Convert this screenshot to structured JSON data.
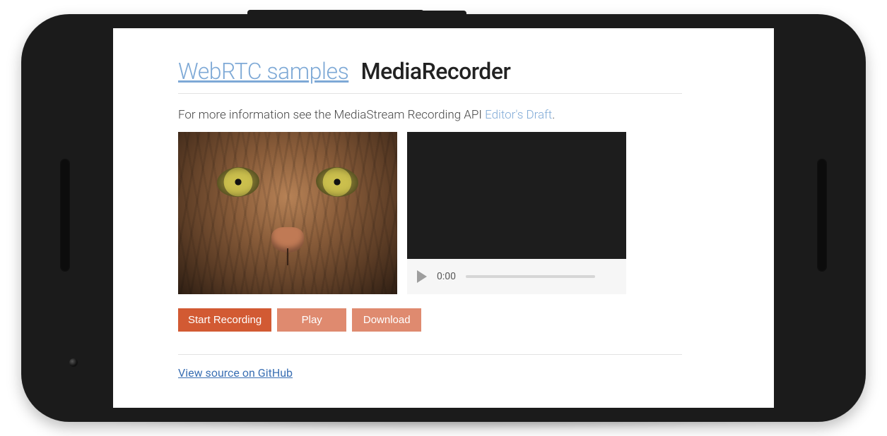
{
  "header": {
    "link_label": "WebRTC samples",
    "title": "MediaRecorder"
  },
  "intro": {
    "prefix": "For more information see the MediaStream Recording API ",
    "link_label": "Editor's Draft",
    "suffix": "."
  },
  "player": {
    "current_time": "0:00"
  },
  "buttons": {
    "start": "Start Recording",
    "play": "Play",
    "download": "Download"
  },
  "footer": {
    "github_link": "View source on GitHub"
  }
}
